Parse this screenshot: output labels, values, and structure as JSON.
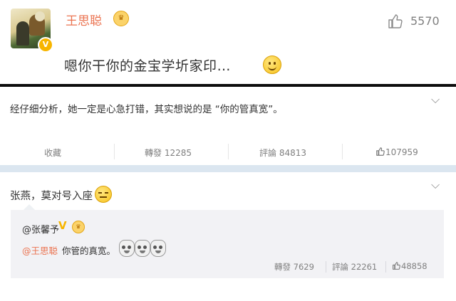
{
  "comment": {
    "username": "王思聪",
    "text": "嗯你干你的金宝学圻家印…",
    "like_count": "5570",
    "icons": [
      "avatar",
      "verified-v-icon",
      "crown-badge-icon",
      "thumb-up-icon",
      "smiley-emoji-icon"
    ]
  },
  "post": {
    "text": "经仔细分析，她一定是心急打错，其实想说的是 “你的管真宽”。",
    "actions": {
      "favorite": "收藏",
      "repost": "轉發 12285",
      "comment": "評論 84813",
      "like": "107959"
    }
  },
  "repost": {
    "text": "张燕，莫对号入座",
    "quoted": {
      "username": "@张馨予",
      "verified_mark": "V",
      "mention": "@王思聪",
      "body": "你管的真宽。",
      "actions": {
        "repost": "轉發 7629",
        "comment": "評論 22261",
        "like": "48858"
      }
    }
  },
  "colors": {
    "username_orange": "#eb7350",
    "gray_text": "#808080",
    "divider_blue": "#dbe6f0",
    "badge_gold": "#f7b500"
  }
}
